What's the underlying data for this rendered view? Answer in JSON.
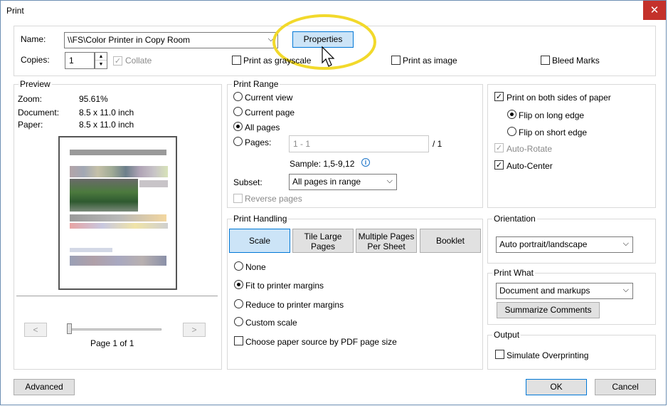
{
  "window": {
    "title": "Print",
    "close_glyph": "✕"
  },
  "printer": {
    "name_label": "Name:",
    "name_value": "\\\\FS\\Color Printer in Copy Room",
    "properties_label": "Properties",
    "copies_label": "Copies:",
    "copies_value": "1",
    "collate_label": "Collate",
    "grayscale_label": "Print as grayscale",
    "image_label": "Print as image",
    "bleed_label": "Bleed Marks"
  },
  "preview": {
    "title": "Preview",
    "zoom_label": "Zoom:",
    "zoom_value": "95.61%",
    "document_label": "Document:",
    "document_value": "8.5 x 11.0 inch",
    "paper_label": "Paper:",
    "paper_value": "8.5 x 11.0 inch",
    "prev_glyph": "<",
    "next_glyph": ">",
    "page_text": "Page 1 of 1"
  },
  "print_range": {
    "title": "Print Range",
    "current_view": "Current view",
    "current_page": "Current page",
    "all_pages": "All pages",
    "pages_label": "Pages:",
    "pages_placeholder": "1 - 1",
    "pages_total": "/ 1",
    "sample": "Sample: 1,5-9,12",
    "subset_label": "Subset:",
    "subset_value": "All pages in range",
    "reverse_label": "Reverse pages"
  },
  "handling": {
    "title": "Print Handling",
    "tabs": [
      "Scale",
      "Tile Large Pages",
      "Multiple Pages Per Sheet",
      "Booklet"
    ],
    "none_label": "None",
    "fit_label": "Fit to printer margins",
    "reduce_label": "Reduce to printer margins",
    "custom_label": "Custom scale",
    "paper_source_label": "Choose paper source by PDF page size"
  },
  "duplex": {
    "both_sides": "Print on both sides of paper",
    "flip_long": "Flip on long edge",
    "flip_short": "Flip on short edge",
    "auto_rotate": "Auto-Rotate",
    "auto_center": "Auto-Center"
  },
  "orientation": {
    "title": "Orientation",
    "value": "Auto portrait/landscape"
  },
  "print_what": {
    "title": "Print What",
    "value": "Document and markups",
    "summarize_label": "Summarize Comments"
  },
  "output": {
    "title": "Output",
    "simulate_label": "Simulate Overprinting"
  },
  "footer": {
    "advanced_label": "Advanced",
    "ok_label": "OK",
    "cancel_label": "Cancel"
  },
  "icons": {
    "dropdown": "⌵",
    "check": "✓",
    "spin_up": "▲",
    "spin_down": "▼",
    "info": "i"
  }
}
